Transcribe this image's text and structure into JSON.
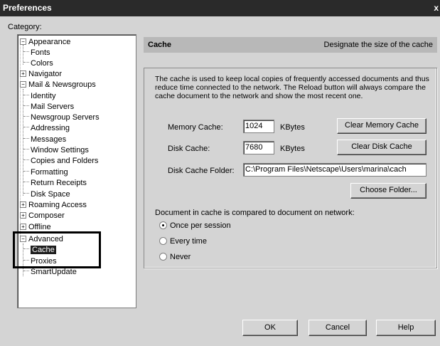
{
  "window": {
    "title": "Preferences",
    "close_glyph": "x"
  },
  "category_label": "Category:",
  "tree": {
    "appearance": "Appearance",
    "fonts": "Fonts",
    "colors": "Colors",
    "navigator": "Navigator",
    "mail_newsgroups": "Mail & Newsgroups",
    "identity": "Identity",
    "mail_servers": "Mail Servers",
    "newsgroup_servers": "Newsgroup Servers",
    "addressing": "Addressing",
    "messages": "Messages",
    "window_settings": "Window Settings",
    "copies_folders": "Copies and Folders",
    "formatting": "Formatting",
    "return_receipts": "Return Receipts",
    "disk_space": "Disk Space",
    "roaming_access": "Roaming Access",
    "composer": "Composer",
    "offline": "Offline",
    "advanced": "Advanced",
    "cache": "Cache",
    "proxies": "Proxies",
    "smartupdate": "SmartUpdate",
    "expand_glyph": "+",
    "collapse_glyph": "−"
  },
  "header": {
    "title": "Cache",
    "description": "Designate the size of the cache"
  },
  "description": "The cache is used to keep local copies of frequently accessed documents and thus reduce time connected to the network. The Reload button will always compare the cache document to the network and show the most recent one.",
  "memory_cache": {
    "label": "Memory Cache:",
    "value": "1024",
    "unit": "KBytes",
    "button": "Clear Memory Cache"
  },
  "disk_cache": {
    "label": "Disk Cache:",
    "value": "7680",
    "unit": "KBytes",
    "button": "Clear Disk Cache"
  },
  "disk_cache_folder": {
    "label": "Disk Cache Folder:",
    "value": "C:\\Program Files\\Netscape\\Users\\marina\\cach",
    "button": "Choose Folder..."
  },
  "compare_label": "Document in cache is compared to document on network:",
  "compare_options": [
    {
      "label": "Once per session",
      "selected": true
    },
    {
      "label": "Every time",
      "selected": false
    },
    {
      "label": "Never",
      "selected": false
    }
  ],
  "buttons": {
    "ok": "OK",
    "cancel": "Cancel",
    "help": "Help"
  }
}
